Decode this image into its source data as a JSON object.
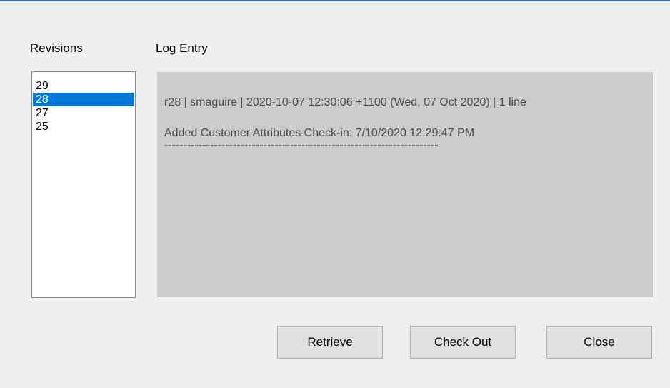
{
  "revisions": {
    "label": "Revisions",
    "items": [
      "29",
      "28",
      "27",
      "25"
    ],
    "selected_index": 1
  },
  "log": {
    "label": "Log Entry",
    "header_line": "r28 | smaguire | 2020-10-07 12:30:06 +1100 (Wed, 07 Oct 2020) | 1 line",
    "message": "Added Customer Attributes Check-in: 7/10/2020 12:29:47 PM",
    "separator": "------------------------------------------------------------------------"
  },
  "buttons": {
    "retrieve": "Retrieve",
    "checkout": "Check Out",
    "close": "Close"
  },
  "colors": {
    "selection": "#0078d7",
    "log_background": "#cbcbcb",
    "window_background": "#f0f0f0"
  }
}
